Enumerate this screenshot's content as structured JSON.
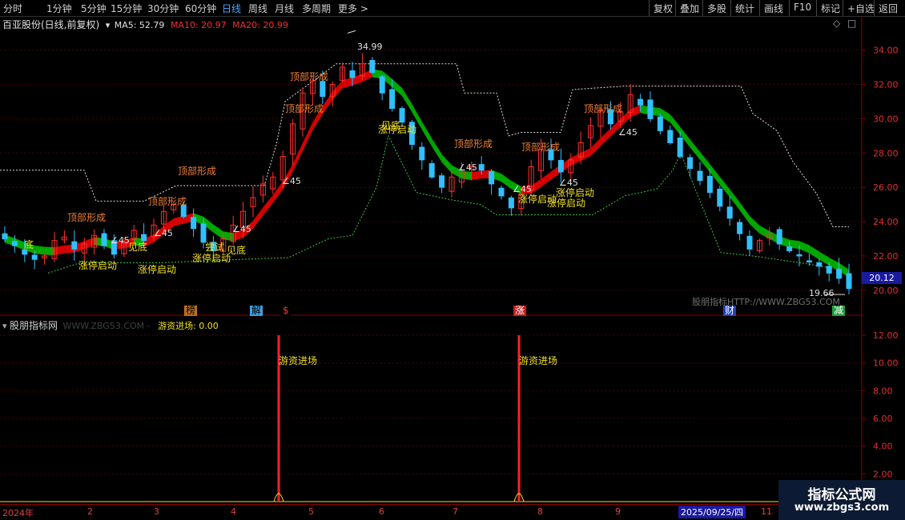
{
  "toolbar": {
    "left_items": [
      "分时",
      "1分钟",
      "5分钟",
      "15分钟",
      "30分钟",
      "60分钟",
      "日线",
      "周线",
      "月线",
      "多周期",
      "更多 >"
    ],
    "active": "日线",
    "right_items": [
      "复权",
      "叠加",
      "多股",
      "统计",
      "画线",
      "F10",
      "标记",
      "+自选",
      "返回"
    ]
  },
  "stock": {
    "title": "百亚股份(日线,前复权)",
    "ma5": "MA5: 52.79",
    "ma10": "MA10: 20.97",
    "ma20": "MA20: 20.99",
    "current_price": "20.12"
  },
  "colors": {
    "up": "#ff3030",
    "down": "#30c0ff",
    "ma_up": "#e00000",
    "ma_down": "#00b000",
    "axis": "#e03030"
  },
  "main_chart_labels": {
    "high_marker": "34.99",
    "low_marker": "19.66",
    "watermark": "股朋指标HTTP://WWW.ZBG53.COM",
    "top_signals": [
      "顶部形成",
      "顶部形成",
      "顶部形成",
      "顶部形成",
      "顶部形成",
      "顶部形成",
      "顶部形成"
    ],
    "bottom_signals": [
      "底",
      "涨停启动",
      "涨停启动",
      "涨停启动",
      "尝试",
      "见底",
      "涨停启动",
      "见底",
      "涨停启动",
      "涨停启动",
      "涨停启动",
      "见底"
    ],
    "arrow_value": "45"
  },
  "event_tags": [
    {
      "text": "榜",
      "bg": "#c07020",
      "color": "#000000"
    },
    {
      "text": "解",
      "bg": "#40a0e0",
      "color": "#000000"
    },
    {
      "text": "$",
      "bg": "#000000",
      "color": "#ff3030"
    },
    {
      "text": "涨",
      "bg": "#c02020",
      "color": "#ffffff"
    },
    {
      "text": "财",
      "bg": "#2040c0",
      "color": "#ffffff"
    },
    {
      "text": "减",
      "bg": "#20a040",
      "color": "#ffffff"
    }
  ],
  "indicator": {
    "title": "股朋指标网",
    "watermark": "WWW.ZBG53.COM - ",
    "line_label": "游资进场: 0.00",
    "signal_text": "游资进场"
  },
  "x_axis": {
    "labels": [
      "2024年",
      "2",
      "3",
      "4",
      "5",
      "6",
      "7",
      "8",
      "9",
      "11"
    ],
    "cursor_date": "2025/09/25/四"
  },
  "branding": {
    "title": "指标公式网",
    "url": "www.zbgs3.com"
  },
  "chart_data": {
    "type": "candlestick",
    "y_ticks": [
      20,
      22,
      24,
      26,
      28,
      30,
      32,
      34
    ],
    "y_tick_labels": [
      "20.00",
      "22.00",
      "24.00",
      "26.00",
      "28.00",
      "30.00",
      "32.00",
      "34.00"
    ],
    "ylim": [
      19.2,
      35.8
    ],
    "indicator_ticks": [
      2,
      4,
      6,
      8,
      10,
      12
    ],
    "indicator_tick_labels": [
      "2.00",
      "4.00",
      "6.00",
      "8.00",
      "10.00",
      "12.00"
    ],
    "indicator_ylim": [
      0,
      13.1
    ],
    "indicator_spikes": [
      12,
      12
    ],
    "close_path": [
      23.0,
      22.6,
      22.1,
      21.8,
      22.0,
      22.9,
      23.1,
      22.4,
      22.7,
      23.2,
      22.6,
      22.1,
      22.8,
      23.5,
      22.9,
      23.8,
      24.6,
      25.0,
      24.3,
      23.6,
      22.8,
      22.3,
      23.0,
      23.8,
      24.6,
      25.4,
      26.2,
      26.6,
      27.8,
      29.7,
      31.5,
      32.2,
      31.3,
      32.0,
      33.0,
      32.4,
      33.2,
      32.7,
      31.5,
      30.6,
      29.8,
      28.5,
      27.6,
      26.6,
      26.0,
      26.6,
      26.9,
      27.2,
      27.0,
      26.2,
      25.5,
      24.8,
      25.6,
      27.2,
      28.2,
      27.6,
      26.9,
      27.6,
      28.6,
      29.6,
      30.5,
      29.7,
      30.4,
      31.4,
      30.8,
      30.0,
      29.3,
      28.6,
      27.8,
      27.1,
      26.4,
      25.7,
      24.9,
      24.2,
      23.3,
      22.4,
      22.9,
      23.3,
      22.7,
      22.3,
      22.0,
      21.7,
      21.4,
      21.0,
      20.7,
      20.1
    ]
  }
}
